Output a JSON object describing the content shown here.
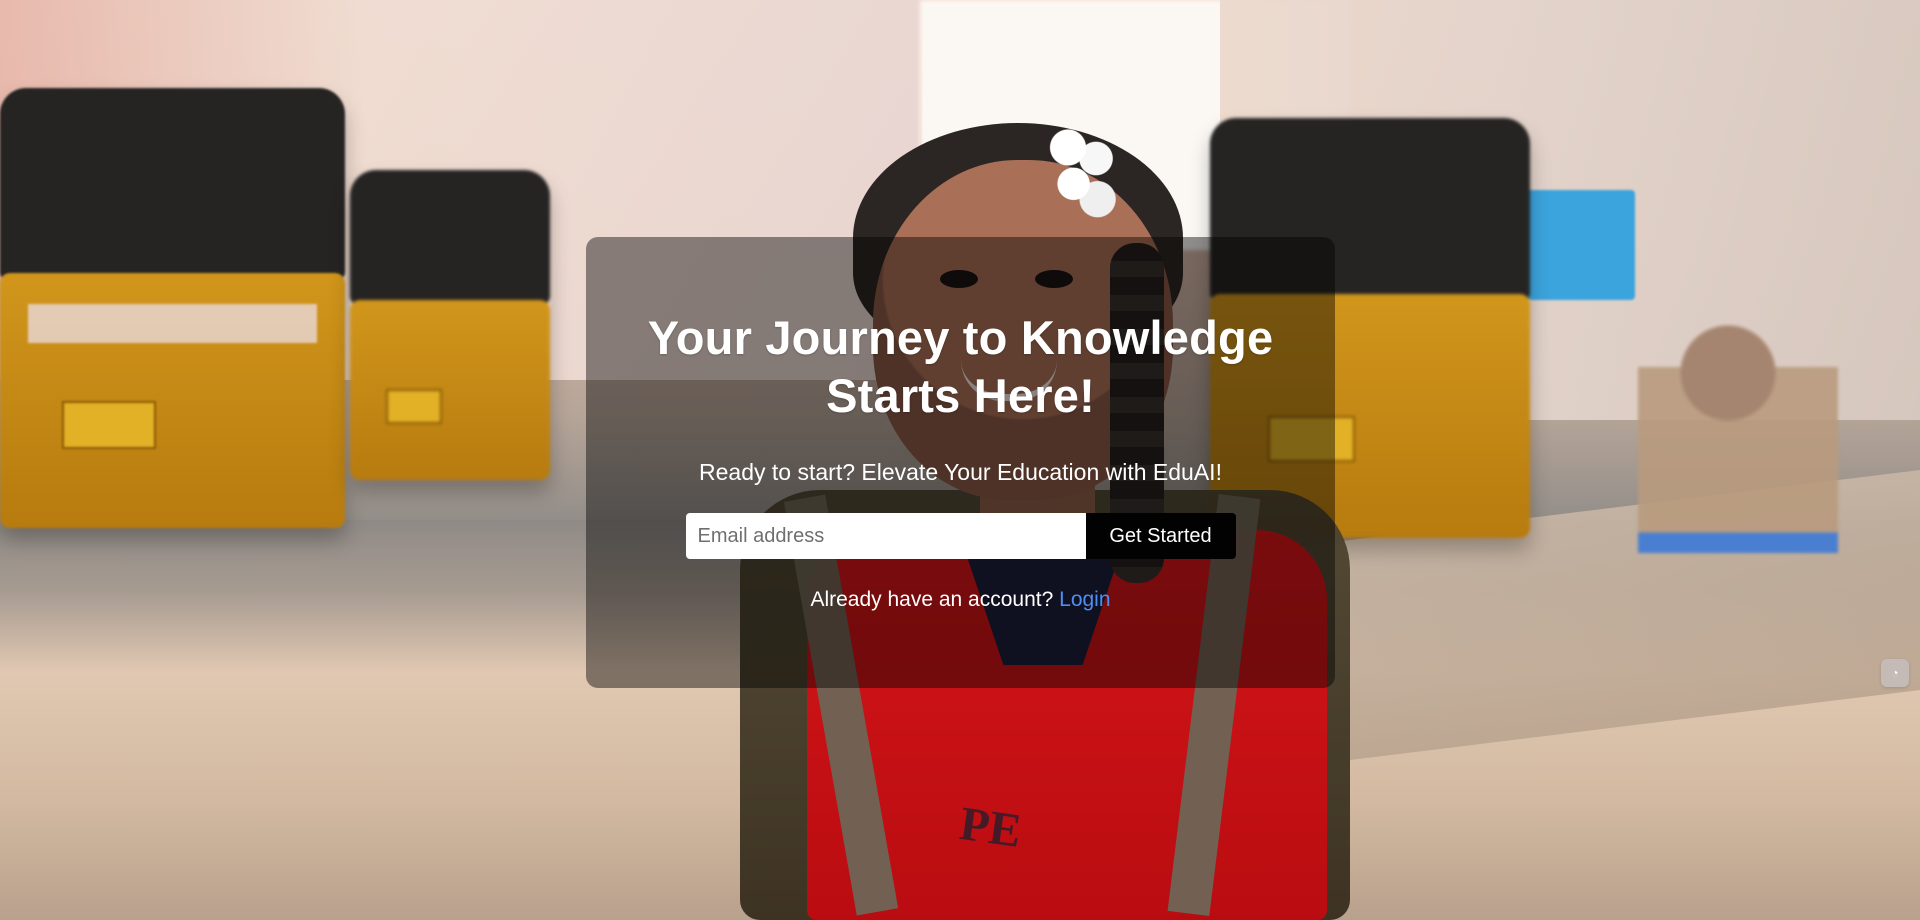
{
  "hero": {
    "headline_line_1": "Your Journey to Knowledge",
    "headline_line_2": "Starts Here!",
    "subheadline": "Ready to start? Elevate Your Education with EduAI!",
    "email_placeholder": "Email address",
    "email_value": "",
    "cta_label": "Get Started",
    "login_prompt": "Already have an account?",
    "login_link_label": "Login"
  },
  "corner_widget": {
    "icon": "face-icon"
  },
  "colors": {
    "overlay": "#000000",
    "link": "#4e8ef2",
    "button": "#020202",
    "text": "#ffffff"
  }
}
